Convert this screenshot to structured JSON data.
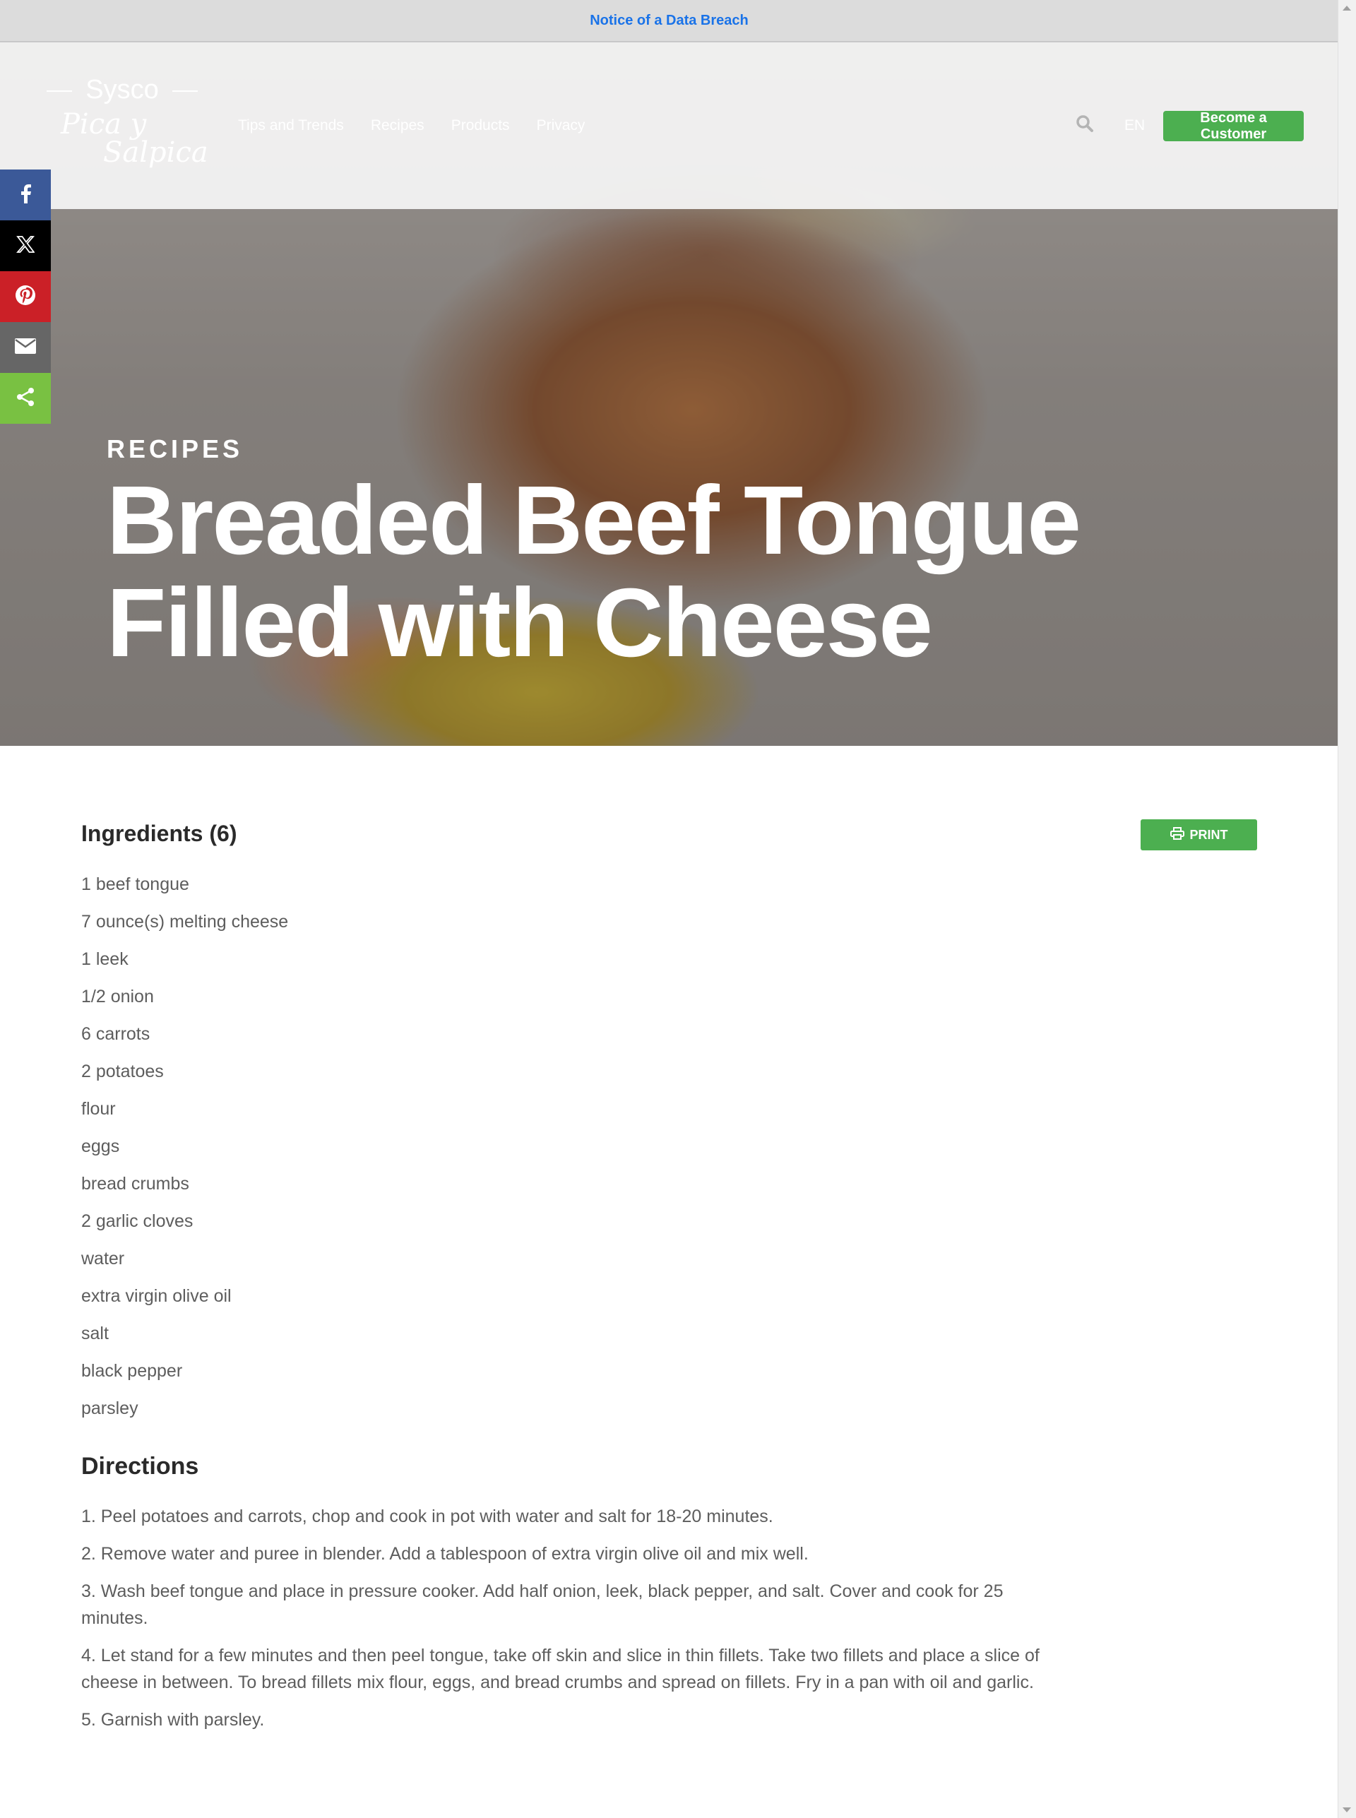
{
  "notice": {
    "label": "Notice of a Data Breach"
  },
  "header": {
    "logo_brand": "Sysco",
    "logo_line1": "Pica y",
    "logo_line2": "Salpica",
    "nav": [
      "Tips and Trends",
      "Recipes",
      "Products",
      "Privacy"
    ],
    "language": "EN",
    "cta_label": "Become a Customer"
  },
  "share": {
    "icons": [
      "facebook-icon",
      "x-icon",
      "pinterest-icon",
      "email-icon",
      "share-icon"
    ]
  },
  "hero": {
    "kicker": "RECIPES",
    "title_line1": "Breaded Beef Tongue",
    "title_line2": "Filled with Cheese"
  },
  "ingredients": {
    "title": "Ingredients (6)",
    "print_label": "PRINT",
    "items": [
      "1 beef tongue",
      "7 ounce(s) melting cheese",
      "1 leek",
      "1/2 onion",
      "6 carrots",
      "2 potatoes",
      "flour",
      "eggs",
      "bread crumbs",
      "2 garlic cloves",
      "water",
      "extra virgin olive oil",
      "salt",
      "black pepper",
      "parsley"
    ]
  },
  "directions": {
    "title": "Directions",
    "steps": [
      "1. Peel potatoes and carrots, chop and cook in pot with water and salt for 18-20 minutes.",
      "2. Remove water and puree in blender. Add a tablespoon of extra virgin olive oil and mix well.",
      "3. Wash beef tongue and place in pressure cooker. Add half onion, leek, black pepper, and salt. Cover and cook for 25 minutes.",
      "4. Let stand for a few minutes and then peel tongue, take off skin and slice in thin fillets. Take two fillets and place a slice of cheese in between. To bread fillets mix flour, eggs, and bread crumbs and spread on fillets. Fry in a pan with oil and garlic.",
      "5. Garnish with parsley."
    ]
  },
  "colors": {
    "accent_green": "#4caf50",
    "notice_link": "#1a73e8",
    "facebook": "#3b5998",
    "x": "#000000",
    "pinterest": "#cb2027",
    "email": "#666666",
    "share": "#79c142"
  }
}
